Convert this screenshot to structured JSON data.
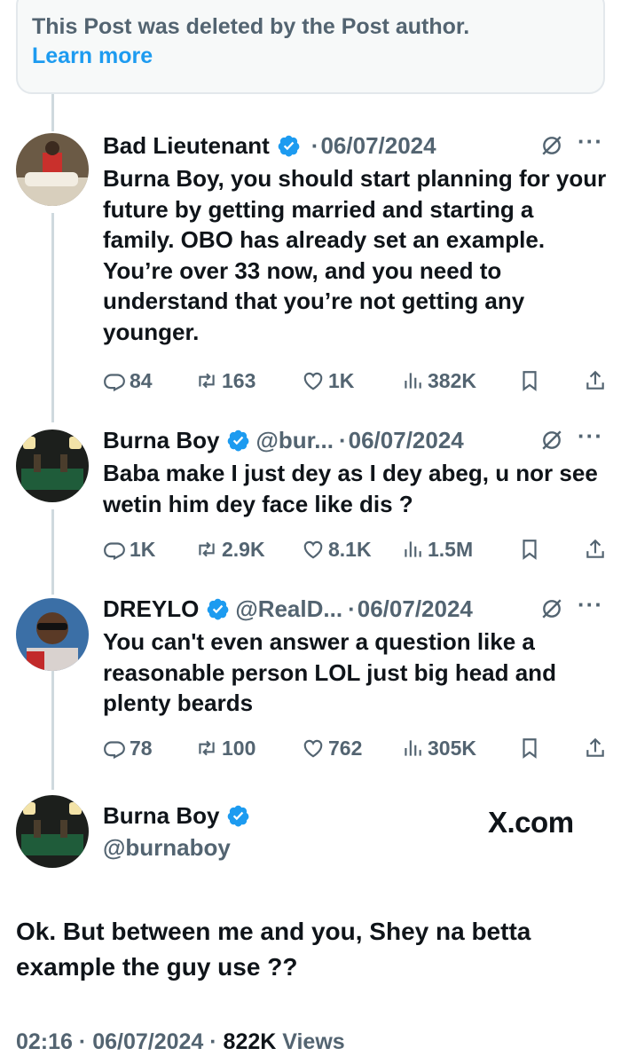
{
  "deleted_notice": {
    "text": "This Post was deleted by the Post author.",
    "learn_more": "Learn more"
  },
  "replies": [
    {
      "name": "Bad Lieutenant",
      "handle": "",
      "date": "06/07/2024",
      "text": "Burna Boy, you should start planning for your future by getting married and starting a family. OBO has already set an example. You’re over 33 now, and you need to understand that you’re not getting any younger.",
      "stats": {
        "replies": "84",
        "reposts": "163",
        "likes": "1K",
        "views": "382K"
      }
    },
    {
      "name": "Burna Boy",
      "handle": "@bur...",
      "date": "06/07/2024",
      "text": "Baba make I just dey as I dey abeg, u nor see wetin him dey face like dis ?",
      "stats": {
        "replies": "1K",
        "reposts": "2.9K",
        "likes": "8.1K",
        "views": "1.5M"
      }
    },
    {
      "name": "DREYLO",
      "handle": "@RealD...",
      "date": "06/07/2024",
      "text": "You can't even answer a question like a reasonable person LOL just big head and plenty beards",
      "stats": {
        "replies": "78",
        "reposts": "100",
        "likes": "762",
        "views": "305K"
      }
    }
  ],
  "main_post": {
    "name": "Burna Boy",
    "handle": "@burnaboy",
    "watermark": "X.com",
    "text": "Ok. But between me and you, Shey na betta example the guy use ??",
    "time": "02:16",
    "date": "06/07/2024",
    "views_count": "822K",
    "views_label": "Views",
    "separator": "·"
  },
  "icons": {
    "verified": "verified-badge-icon",
    "grok": "grok-icon",
    "more": "more-icon",
    "reply": "reply-icon",
    "repost": "repost-icon",
    "like": "heart-icon",
    "views": "views-chart-icon",
    "bookmark": "bookmark-icon",
    "share": "share-icon"
  },
  "colors": {
    "verified_blue": "#1d9bf0",
    "link_blue": "#1d9bf0",
    "secondary_text": "#536471",
    "primary_text": "#0f1419",
    "thread_line": "#cfd9de"
  }
}
